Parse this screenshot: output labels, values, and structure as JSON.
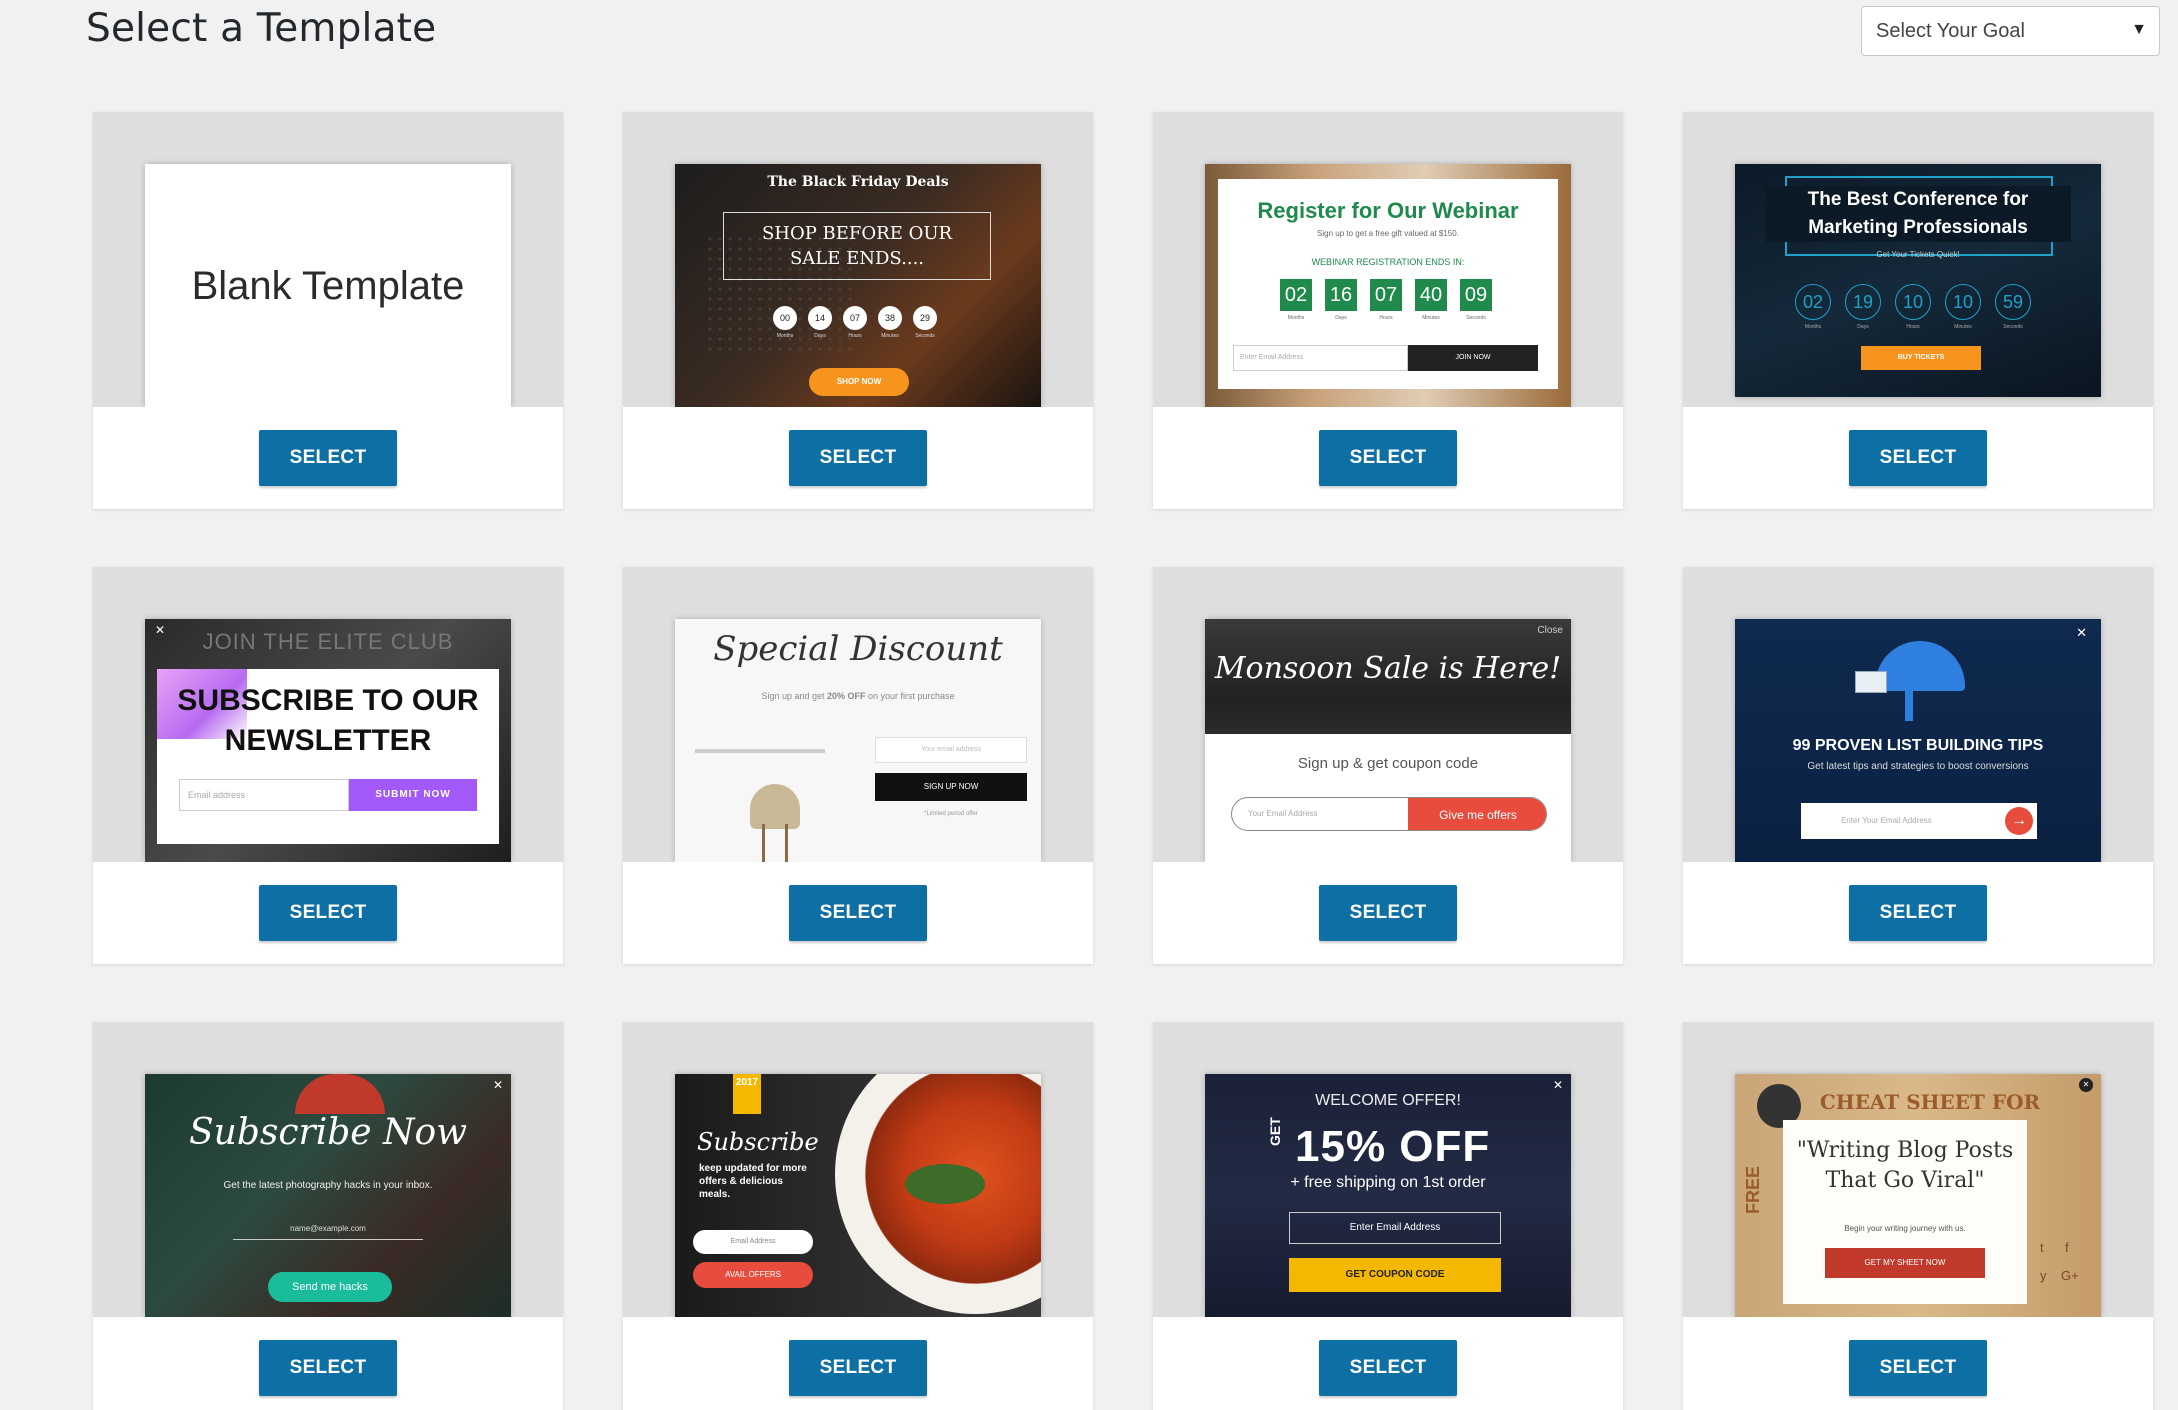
{
  "header": {
    "title": "Select a Template",
    "goal_select": {
      "value": "Select Your Goal",
      "caret": "▼"
    }
  },
  "select_label": "SELECT",
  "templates": [
    {
      "id": "blank",
      "heading": "Blank Template"
    },
    {
      "id": "black-friday",
      "kicker": "The Black Friday Deals",
      "heading": "SHOP BEFORE OUR SALE ENDS....",
      "counter": [
        "00",
        "14",
        "07",
        "38",
        "29"
      ],
      "units": [
        "Months",
        "Days",
        "Hours",
        "Minutes",
        "Seconds"
      ],
      "cta": "SHOP NOW"
    },
    {
      "id": "webinar",
      "heading": "Register for Our Webinar",
      "sub": "Sign up to get a free gift valued at $150.",
      "note": "WEBINAR REGISTRATION ENDS IN:",
      "counter": [
        "02",
        "16",
        "07",
        "40",
        "09"
      ],
      "units": [
        "Months",
        "Days",
        "Hours",
        "Minutes",
        "Seconds"
      ],
      "input": "Enter Email Address",
      "cta": "JOIN NOW"
    },
    {
      "id": "conference",
      "heading": "The Best Conference for Marketing Professionals",
      "sub": "Get Your Tickets Quick!",
      "counter": [
        "02",
        "19",
        "10",
        "10",
        "59"
      ],
      "units": [
        "Months",
        "Days",
        "Hours",
        "Minutes",
        "Seconds"
      ],
      "cta": "BUY TICKETS"
    },
    {
      "id": "elite-club",
      "kicker": "JOIN THE ELITE CLUB",
      "heading": "SUBSCRIBE TO OUR NEWSLETTER",
      "input": "Email address",
      "cta": "SUBMIT NOW",
      "close": "✕"
    },
    {
      "id": "special-discount",
      "heading": "Special Discount",
      "sub_a": "Sign up and get ",
      "sub_b": "20% OFF",
      "sub_c": " on your first purchase",
      "input": "Your email address",
      "cta": "SIGN UP NOW",
      "note": "*Limited period offer"
    },
    {
      "id": "monsoon",
      "heading": "Monsoon Sale is Here!",
      "close": "Close",
      "sub": "Sign up & get coupon code",
      "input": "Your Email Address",
      "cta": "Give me offers"
    },
    {
      "id": "list-building",
      "heading": "99 PROVEN LIST BUILDING TIPS",
      "sub": "Get latest tips and strategies to boost conversions",
      "input": "Enter Your Email Address",
      "close": "✕"
    },
    {
      "id": "subscribe-now",
      "heading": "Subscribe Now",
      "sub": "Get the latest photography hacks in your inbox.",
      "input": "name@example.com",
      "cta": "Send me hacks",
      "close": "✕"
    },
    {
      "id": "food",
      "badge": "2017",
      "heading": "Subscribe",
      "sub": "keep updated for more offers & delicious meals.",
      "input": "Email Address",
      "cta": "AVAIL OFFERS"
    },
    {
      "id": "welcome-offer",
      "kicker": "WELCOME OFFER!",
      "get": "GET",
      "heading": "15% OFF",
      "sub": "+ free shipping on 1st order",
      "input": "Enter Email Address",
      "cta": "GET COUPON CODE",
      "close": "✕"
    },
    {
      "id": "cheat-sheet",
      "kicker": "CHEAT SHEET FOR",
      "side": "FREE",
      "heading": "\"Writing Blog Posts That Go Viral\"",
      "sub": "Begin your writing journey with us.",
      "cta": "GET MY SHEET NOW",
      "close": "✕",
      "social": [
        "t",
        "f",
        "y",
        "G+"
      ]
    }
  ],
  "colors": {
    "button": "#0d6fa3",
    "page_bg": "#f1f1f1",
    "webinar_green": "#1f8a4c",
    "conference_cyan": "#1fa2c9",
    "monsoon_red": "#e74c3c",
    "welcome_yellow": "#f5b800",
    "elite_purple": "#a259f7",
    "cheat_red": "#c0392b"
  }
}
